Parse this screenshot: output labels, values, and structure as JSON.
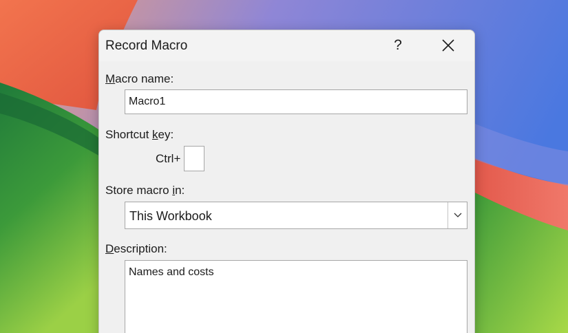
{
  "dialog": {
    "title": "Record Macro",
    "help_label": "?",
    "close_icon": "close-icon"
  },
  "macro_name": {
    "label_accel": "M",
    "label_rest": "acro name:",
    "value": "Macro1"
  },
  "shortcut_key": {
    "label_pre": "Shortcut ",
    "label_accel": "k",
    "label_post": "ey:",
    "ctrl_label": "Ctrl+",
    "value": ""
  },
  "store_macro": {
    "label_pre": "Store macro ",
    "label_accel": "i",
    "label_post": "n:",
    "selected": "This Workbook",
    "arrow_icon": "chevron-down-icon"
  },
  "description": {
    "label_accel": "D",
    "label_rest": "escription:",
    "value": "Names and costs"
  },
  "colors": {
    "dialog_bg": "#f0f0f0",
    "field_border": "#a6a6a6",
    "text": "#1b1b1b"
  }
}
